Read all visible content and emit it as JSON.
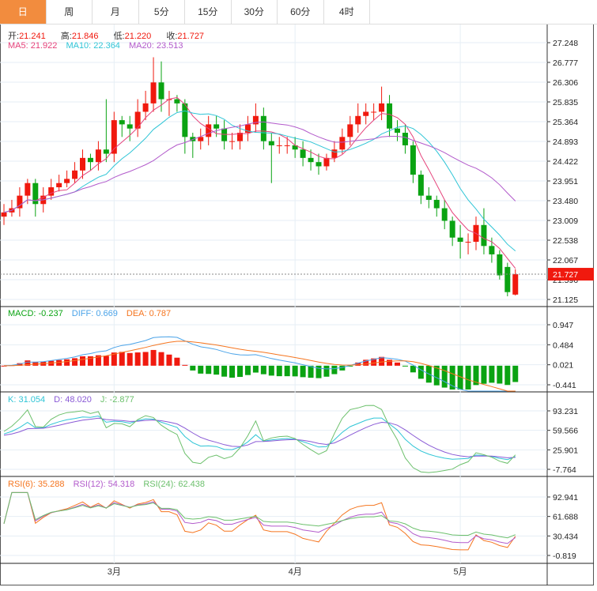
{
  "tabs": [
    "日",
    "周",
    "月",
    "5分",
    "15分",
    "30分",
    "60分",
    "4时"
  ],
  "active_tab": 0,
  "ohlc_legend": {
    "open_label": "开:",
    "open": "21.241",
    "high_label": "高:",
    "high": "21.846",
    "low_label": "低:",
    "low": "21.220",
    "close_label": "收:",
    "close": "21.727"
  },
  "ma_legend": {
    "ma5": "MA5: 21.922",
    "ma10": "MA10: 22.364",
    "ma20": "MA20: 23.513"
  },
  "macd_legend": {
    "macd": "MACD: -0.237",
    "diff": "DIFF: 0.669",
    "dea": "DEA: 0.787"
  },
  "kdj_legend": {
    "k": "K: 31.054",
    "d": "D: 48.020",
    "j": "J: -2.877"
  },
  "rsi_legend": {
    "rsi6": "RSI(6): 35.288",
    "rsi12": "RSI(12): 54.318",
    "rsi24": "RSI(24): 62.438"
  },
  "colors": {
    "up": "#f0190e",
    "down": "#0aa312",
    "ma5": "#e5417a",
    "ma10": "#2fc5d6",
    "ma20": "#b25acb",
    "diff": "#4aa3e8",
    "dea": "#f5751f",
    "k": "#2fc5d6",
    "d": "#8a5ad6",
    "j": "#6cc06c",
    "rsi6": "#f5751f",
    "rsi12": "#b25acb",
    "rsi24": "#6cc06c",
    "tab_active": "#f28c3e"
  },
  "chart_data": {
    "type": "candlestick",
    "price_axis": {
      "ticks": [
        "27.248",
        "26.777",
        "26.306",
        "25.835",
        "25.364",
        "24.893",
        "24.422",
        "23.951",
        "23.480",
        "23.009",
        "22.538",
        "22.067",
        "21.596",
        "21.125"
      ],
      "range": [
        21.125,
        27.248
      ]
    },
    "last_price": "21.727",
    "macd_axis": {
      "ticks": [
        "0.947",
        "0.484",
        "0.021",
        "-0.441"
      ],
      "range": [
        -0.441,
        0.947
      ]
    },
    "kdj_axis": {
      "ticks": [
        "93.231",
        "59.566",
        "25.901",
        "-7.764"
      ],
      "range": [
        -7.764,
        93.231
      ]
    },
    "rsi_axis": {
      "ticks": [
        "92.941",
        "61.688",
        "30.434",
        "-0.819"
      ],
      "range": [
        -0.819,
        92.941
      ]
    },
    "x_labels": [
      {
        "index": 14,
        "label": "3月"
      },
      {
        "index": 37,
        "label": "4月"
      },
      {
        "index": 58,
        "label": "5月"
      }
    ],
    "open": [
      23.1,
      23.2,
      23.3,
      23.6,
      23.9,
      23.4,
      23.6,
      23.8,
      23.9,
      24.0,
      24.2,
      24.5,
      24.4,
      24.7,
      24.6,
      25.4,
      25.3,
      25.2,
      25.6,
      25.8,
      26.3,
      25.9,
      25.9,
      25.8,
      25.0,
      24.9,
      25.0,
      25.3,
      25.2,
      24.9,
      24.9,
      25.1,
      25.3,
      25.5,
      24.9,
      24.8,
      24.8,
      24.8,
      24.7,
      24.5,
      24.4,
      24.3,
      24.5,
      24.7,
      25.0,
      25.3,
      25.5,
      25.6,
      25.6,
      25.8,
      25.2,
      25.1,
      24.8,
      24.1,
      23.6,
      23.5,
      23.3,
      23.0,
      22.6,
      22.5,
      22.5,
      22.9,
      22.4,
      22.2,
      21.9,
      21.241
    ],
    "high": [
      23.4,
      23.5,
      23.8,
      24.0,
      24.0,
      23.8,
      24.0,
      24.1,
      24.2,
      24.4,
      24.7,
      24.6,
      24.9,
      25.9,
      25.6,
      25.5,
      25.5,
      25.9,
      26.1,
      26.9,
      26.8,
      26.1,
      26.0,
      25.9,
      25.1,
      25.2,
      25.5,
      25.5,
      25.4,
      25.1,
      25.3,
      25.5,
      25.8,
      25.7,
      25.1,
      25.0,
      25.0,
      25.0,
      24.9,
      24.7,
      24.6,
      24.6,
      24.9,
      25.2,
      25.5,
      25.8,
      25.8,
      25.8,
      26.2,
      26.0,
      25.4,
      25.3,
      24.9,
      24.2,
      23.8,
      23.6,
      23.5,
      23.1,
      22.9,
      22.7,
      23.1,
      23.3,
      22.6,
      22.3,
      22.0,
      21.846
    ],
    "low": [
      22.9,
      23.1,
      23.1,
      23.4,
      23.1,
      23.2,
      23.5,
      23.7,
      23.8,
      23.9,
      24.0,
      24.2,
      24.2,
      24.4,
      24.4,
      25.0,
      24.9,
      25.0,
      25.4,
      25.6,
      25.6,
      25.5,
      25.6,
      24.6,
      24.5,
      24.7,
      24.8,
      25.0,
      24.7,
      24.7,
      24.7,
      24.9,
      25.1,
      24.7,
      23.9,
      24.6,
      24.6,
      24.5,
      24.3,
      24.2,
      24.1,
      24.2,
      24.4,
      24.6,
      24.8,
      25.1,
      25.3,
      25.4,
      25.4,
      25.0,
      24.9,
      24.6,
      23.9,
      23.4,
      23.3,
      23.1,
      22.8,
      22.4,
      22.1,
      22.2,
      22.3,
      22.2,
      22.0,
      21.6,
      21.2,
      21.22
    ],
    "close": [
      23.2,
      23.3,
      23.6,
      23.9,
      23.4,
      23.6,
      23.8,
      23.9,
      24.0,
      24.2,
      24.5,
      24.4,
      24.7,
      24.6,
      25.4,
      25.3,
      25.2,
      25.6,
      25.8,
      26.3,
      25.9,
      25.9,
      25.8,
      25.0,
      24.9,
      25.0,
      25.3,
      25.2,
      24.9,
      24.9,
      25.1,
      25.3,
      25.5,
      24.9,
      24.8,
      24.8,
      24.8,
      24.7,
      24.5,
      24.4,
      24.3,
      24.5,
      24.7,
      25.0,
      25.3,
      25.5,
      25.6,
      25.6,
      25.8,
      25.2,
      25.1,
      24.8,
      24.1,
      23.6,
      23.5,
      23.3,
      23.0,
      22.6,
      22.5,
      22.5,
      22.9,
      22.4,
      22.2,
      21.7,
      21.3,
      21.727
    ]
  }
}
